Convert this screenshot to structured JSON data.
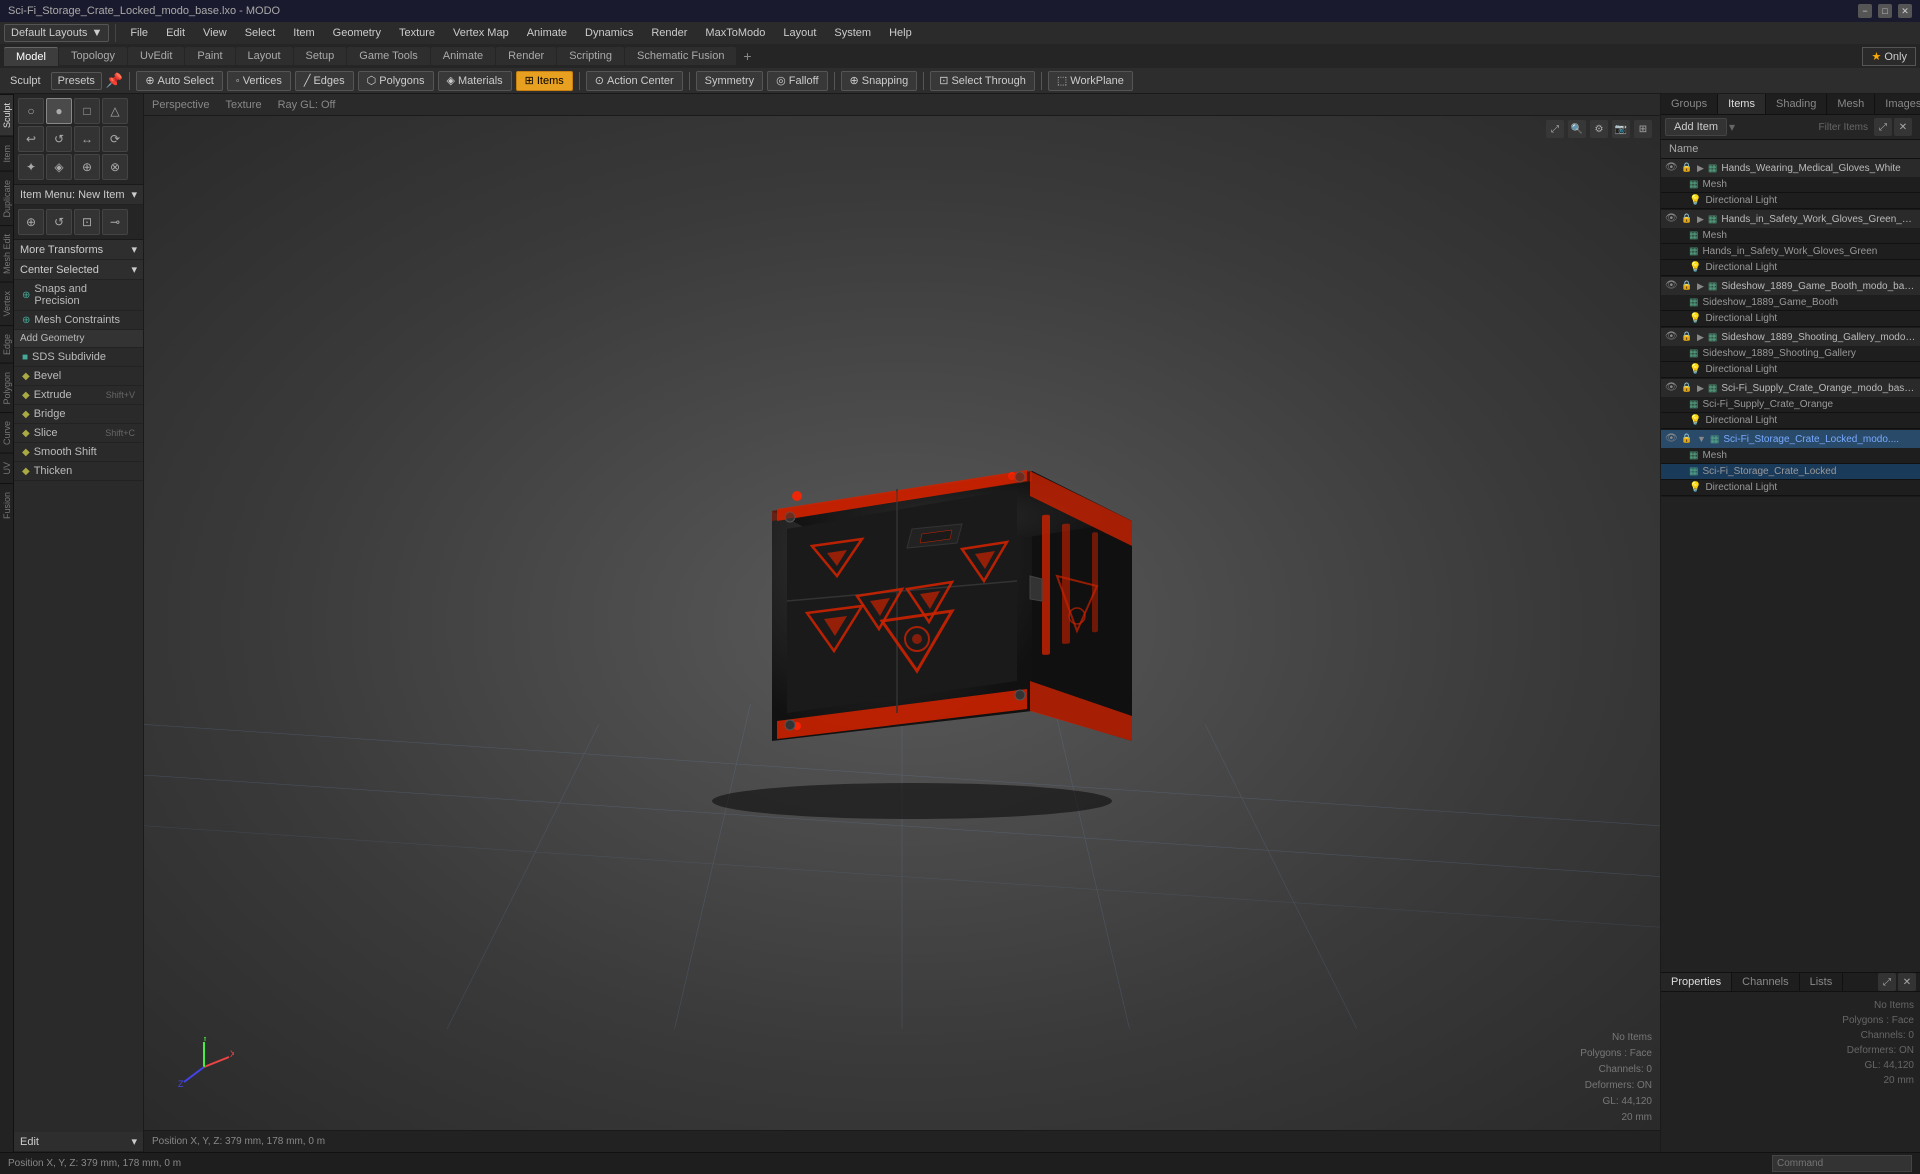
{
  "titlebar": {
    "title": "Sci-Fi_Storage_Crate_Locked_modo_base.lxo - MODO",
    "controls": [
      "−",
      "□",
      "✕"
    ]
  },
  "menubar": {
    "items": [
      "File",
      "Edit",
      "View",
      "Select",
      "Item",
      "Geometry",
      "Texture",
      "Vertex Map",
      "Animate",
      "Dynamics",
      "Render",
      "MaxToModo",
      "Layout",
      "System",
      "Help"
    ]
  },
  "tabs": {
    "items": [
      "Model",
      "Topology",
      "UvEdit",
      "Paint",
      "Layout",
      "Setup",
      "Game Tools",
      "Animate",
      "Render",
      "Scripting",
      "Schematic Fusion"
    ],
    "active": "Model",
    "add_label": "+"
  },
  "layout_dropdown": "Default Layouts",
  "only_btn": "⭐ Only",
  "toolbar": {
    "sculpt_label": "Sculpt",
    "presets_label": "Presets",
    "auto_select": "Auto Select",
    "vertices": "Vertices",
    "edges": "Edges",
    "polygons": "Polygons",
    "materials": "Materials",
    "items": "Items",
    "action_center": "Action Center",
    "symmetry": "Symmetry",
    "falloff": "Falloff",
    "snapping": "Snapping",
    "select_through": "Select Through",
    "workplane": "WorkPlane"
  },
  "viewport": {
    "view_type": "Perspective",
    "render_type": "Texture",
    "ray_status": "Ray GL: Off"
  },
  "left_panel": {
    "icon_rows": [
      "○",
      "●",
      "□",
      "△",
      "↩",
      "↺",
      "↔",
      "⟳",
      "✦",
      "◈",
      "⊕",
      "⊗"
    ],
    "more_transforms": "More Transforms",
    "center_selected": "Center Selected",
    "snaps_precision": "Snaps and Precision",
    "mesh_constraints": "Mesh Constraints",
    "add_geometry": "Add Geometry",
    "items": [
      {
        "label": "SDS Subdivide",
        "icon": "■",
        "shortcut": ""
      },
      {
        "label": "Bevel",
        "icon": "◆",
        "shortcut": ""
      },
      {
        "label": "Extrude",
        "icon": "◆",
        "shortcut": "Shift+V"
      },
      {
        "label": "Bridge",
        "icon": "◆",
        "shortcut": ""
      },
      {
        "label": "Slice",
        "icon": "◆",
        "shortcut": "Shift+C"
      },
      {
        "label": "Smooth Shift",
        "icon": "◆",
        "shortcut": ""
      },
      {
        "label": "Thicken",
        "icon": "◆",
        "shortcut": ""
      }
    ],
    "edit_label": "Edit",
    "vert_tabs": [
      "Sculpt",
      "Item",
      "Duplicate",
      "Mesh Edit",
      "Vertex",
      "Edge",
      "Polygon",
      "Curve",
      "UV",
      "Fusion"
    ]
  },
  "right_panel": {
    "tabs": [
      "Groups",
      "Items",
      "Shading",
      "Mesh",
      "Images"
    ],
    "active_tab": "Items",
    "add_item_label": "Add Item",
    "add_item_dropdown": "▼",
    "filter_placeholder": "Filter Items",
    "column_header": "Name",
    "items_list": [
      {
        "name": "Hands_Wearing_Medical_Gloves_White",
        "type": "group",
        "expanded": true,
        "children": [
          {
            "name": "Mesh",
            "type": "mesh"
          },
          {
            "name": "Directional Light",
            "type": "light"
          }
        ]
      },
      {
        "name": "Hands_in_Safety_Work_Gloves_Green_mo...",
        "type": "group",
        "expanded": true,
        "children": [
          {
            "name": "Mesh",
            "type": "mesh"
          },
          {
            "name": "Hands_in_Safety_Work_Gloves_Green",
            "type": "mesh"
          },
          {
            "name": "Directional Light",
            "type": "light"
          }
        ]
      },
      {
        "name": "Sideshow_1889_Game_Booth_modo_base....",
        "type": "group",
        "expanded": true,
        "children": [
          {
            "name": "Sideshow_1889_Game_Booth",
            "type": "mesh"
          },
          {
            "name": "Directional Light",
            "type": "light"
          }
        ]
      },
      {
        "name": "Sideshow_1889_Shooting_Gallery_modo_b...",
        "type": "group",
        "expanded": true,
        "children": [
          {
            "name": "Sideshow_1889_Shooting_Gallery",
            "type": "mesh"
          },
          {
            "name": "Directional Light",
            "type": "light"
          }
        ]
      },
      {
        "name": "Sci-Fi_Supply_Crate_Orange_modo_base.lxo",
        "type": "group",
        "expanded": true,
        "children": [
          {
            "name": "Sci-Fi_Supply_Crate_Orange",
            "type": "mesh"
          },
          {
            "name": "Directional Light",
            "type": "light"
          }
        ]
      },
      {
        "name": "Sci-Fi_Storage_Crate_Locked_modo...",
        "type": "group",
        "expanded": true,
        "selected": true,
        "children": [
          {
            "name": "Mesh",
            "type": "mesh"
          },
          {
            "name": "Sci-Fi_Storage_Crate_Locked",
            "type": "mesh",
            "selected": true
          },
          {
            "name": "Directional Light",
            "type": "light"
          }
        ]
      }
    ],
    "bottom_tabs": [
      "Properties",
      "Channels",
      "Lists"
    ],
    "active_bottom_tab": "Properties",
    "properties": {
      "no_items": "No Items",
      "polygons_face": "Polygons : Face",
      "channels": "Channels: 0",
      "deformers": "Deformers: ON",
      "gl": "GL: 44,120",
      "mm": "20 mm"
    }
  },
  "statusbar": {
    "position": "Position X, Y, Z:  379 mm, 178 mm, 0 m",
    "command_placeholder": "Command"
  }
}
